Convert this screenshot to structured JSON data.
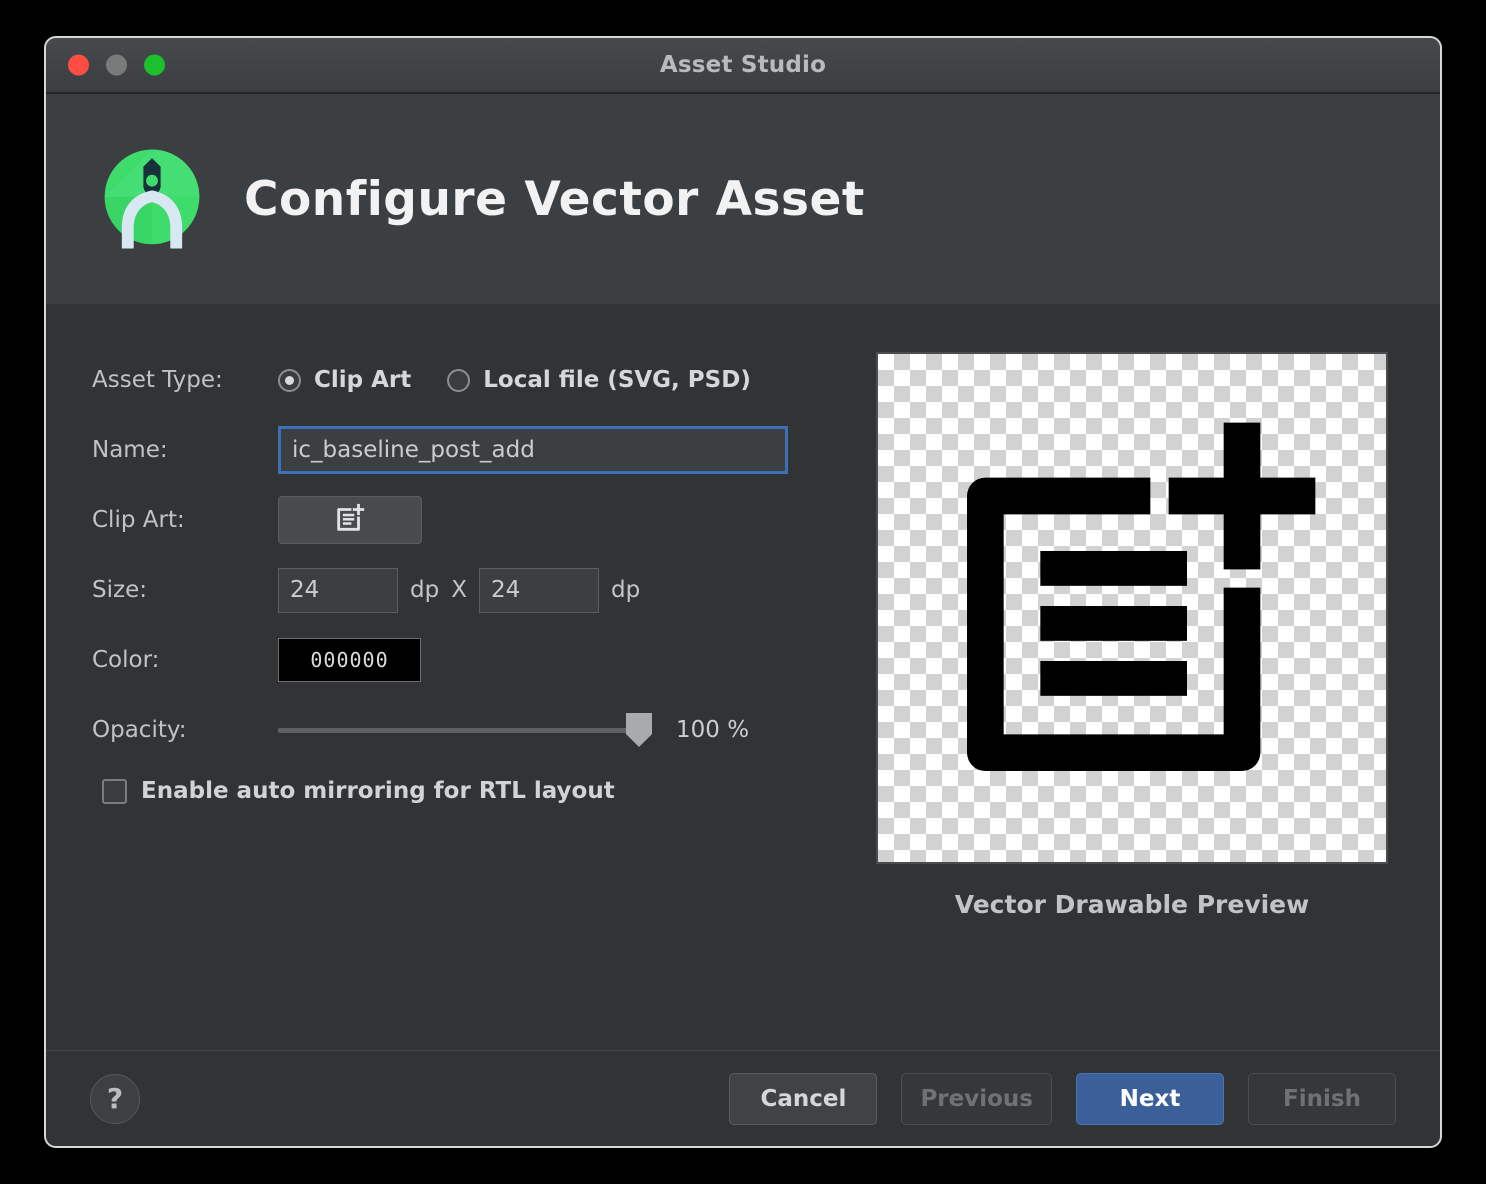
{
  "window": {
    "title": "Asset Studio",
    "traffic_lights": [
      "close",
      "minimize",
      "zoom"
    ]
  },
  "header": {
    "title": "Configure Vector Asset",
    "logo": "android-studio-logo"
  },
  "form": {
    "asset_type": {
      "label": "Asset Type:",
      "options": [
        {
          "label": "Clip Art",
          "selected": true
        },
        {
          "label": "Local file (SVG, PSD)",
          "selected": false
        }
      ]
    },
    "name": {
      "label": "Name:",
      "value": "ic_baseline_post_add",
      "placeholder": "",
      "focused": true
    },
    "clip_art": {
      "label": "Clip Art:",
      "icon": "post-add-icon"
    },
    "size": {
      "label": "Size:",
      "width_value": "24",
      "height_value": "24",
      "unit": "dp",
      "separator": "X"
    },
    "color": {
      "label": "Color:",
      "hex": "000000",
      "swatch_color": "#000000"
    },
    "opacity": {
      "label": "Opacity:",
      "value": 100,
      "value_text": "100 %",
      "min": 0,
      "max": 100
    },
    "rtl_mirroring": {
      "label": "Enable auto mirroring for RTL layout",
      "checked": false
    }
  },
  "preview": {
    "caption": "Vector Drawable Preview",
    "icon": "post-add-icon",
    "icon_color": "#000000",
    "background": "transparency-checkerboard"
  },
  "footer": {
    "help_label": "?",
    "buttons": [
      {
        "label": "Cancel",
        "state": "enabled"
      },
      {
        "label": "Previous",
        "state": "disabled"
      },
      {
        "label": "Next",
        "state": "primary"
      },
      {
        "label": "Finish",
        "state": "disabled"
      }
    ]
  },
  "colors": {
    "accent_blue": "#3b6099",
    "focus_blue": "#3d6fb8",
    "header_bg": "#3c3f41",
    "body_bg": "#313335",
    "text": "#c9cdcf"
  }
}
